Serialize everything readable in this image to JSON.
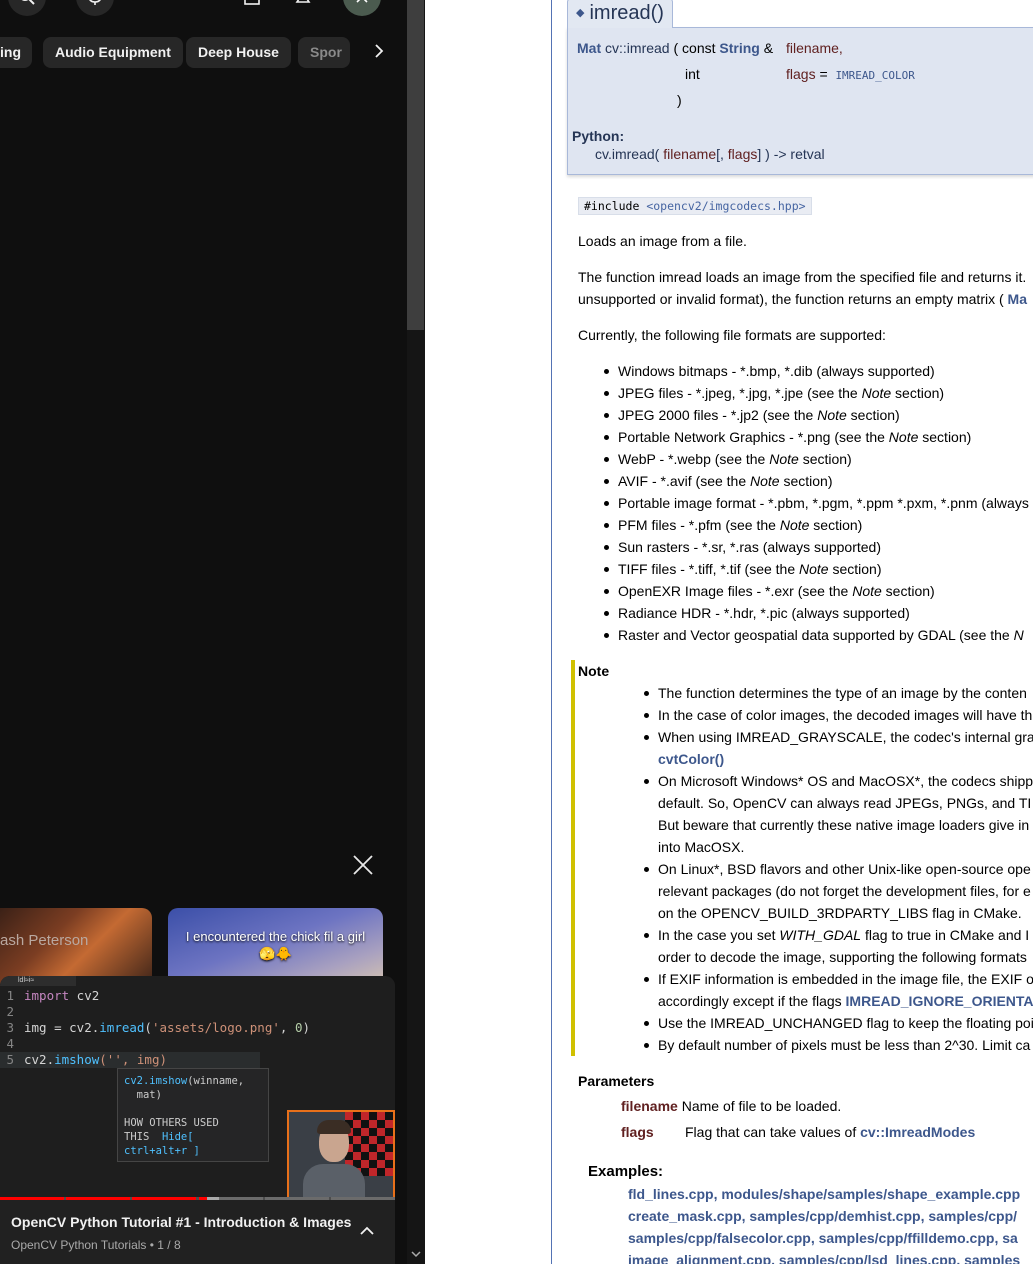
{
  "youtube": {
    "chips": [
      "ing",
      "Audio Equipment",
      "Deep House",
      "Spor"
    ],
    "shorts": [
      {
        "title": "ash Peterson"
      },
      {
        "title": "I encountered the chick fil a girl 🫣🐥"
      }
    ],
    "mini_player": {
      "editor_tab": "ldl≈i≈",
      "code": {
        "l1_num": "1",
        "l1_kw": "import",
        "l1_rest": " cv2",
        "l2_num": "2",
        "l3_num": "3",
        "l3_a": "img = cv2.",
        "l3_fn": "imread",
        "l3_b": "(",
        "l3_str": "'assets/logo.png'",
        "l3_c": ", ",
        "l3_num_val": "0",
        "l3_d": ")",
        "l4_num": "4",
        "l5_num": "5",
        "l5_a": "cv2.",
        "l5_fn": "imshow",
        "l5_b": "('",
        "l5_c": "', img)"
      },
      "autocomplete": {
        "sig_fn": "cv2.imshow",
        "sig_rest": "(winname,",
        "sig_line2": "  mat)",
        "used_line1": "HOW OTHERS USED",
        "used_line2_a": "THIS  ",
        "used_line2_b": "Hide[",
        "used_line3": "ctrl+alt+r ]"
      },
      "title": "OpenCV Python Tutorial #1 - Introduction & Images",
      "subtitle": "OpenCV Python Tutorials • 1 / 8",
      "progress_segments": [
        {
          "color": "#ff0000",
          "fill": 1.0
        },
        {
          "color": "#ff0000",
          "fill": 1.0
        },
        {
          "color": "#ff0000",
          "fill": 1.0
        },
        {
          "color": "#ff0000",
          "fill": 0.14
        },
        {
          "color": "#4d4d4d",
          "fill": 0.0
        },
        {
          "color": "#4d4d4d",
          "fill": 0.0
        }
      ]
    }
  },
  "doc": {
    "member_title": "imread()",
    "proto": {
      "ret_type": "Mat",
      "name": "cv::imread",
      "paren_open": "(",
      "const_kw": "const",
      "string_type": "String",
      "amp": "&",
      "p1_name": "filename,",
      "int_type": "int",
      "p2_name": "flags",
      "eq": "=",
      "default_val": "IMREAD_COLOR",
      "paren_close": ")"
    },
    "python_label": "Python:",
    "python_sig": {
      "fn": "cv.imread(",
      "p1": "filename",
      "opt": "[, ",
      "p2": "flags",
      "close": "] ) -> retval"
    },
    "include": {
      "prefix": "#include ",
      "path": "<opencv2/imgcodecs.hpp>"
    },
    "brief": "Loads an image from a file.",
    "desc_line1": "The function imread loads an image from the specified file and returns it.",
    "desc_line2_text": "unsupported or invalid format), the function returns an empty matrix ( ",
    "desc_line2_link": "Ma",
    "formats_intro": "Currently, the following file formats are supported:",
    "formats": [
      {
        "a": "Windows bitmaps - *.bmp, *.dib (always supported)",
        "i": "",
        "b": ""
      },
      {
        "a": "JPEG files - *.jpeg, *.jpg, *.jpe (see the ",
        "i": "Note",
        "b": " section)"
      },
      {
        "a": "JPEG 2000 files - *.jp2 (see the ",
        "i": "Note",
        "b": " section)"
      },
      {
        "a": "Portable Network Graphics - *.png (see the ",
        "i": "Note",
        "b": " section)"
      },
      {
        "a": "WebP - *.webp (see the ",
        "i": "Note",
        "b": " section)"
      },
      {
        "a": "AVIF - *.avif (see the ",
        "i": "Note",
        "b": " section)"
      },
      {
        "a": "Portable image format - *.pbm, *.pgm, *.ppm *.pxm, *.pnm (always s",
        "i": "",
        "b": ""
      },
      {
        "a": "PFM files - *.pfm (see the ",
        "i": "Note",
        "b": " section)"
      },
      {
        "a": "Sun rasters - *.sr, *.ras (always supported)",
        "i": "",
        "b": ""
      },
      {
        "a": "TIFF files - *.tiff, *.tif (see the ",
        "i": "Note",
        "b": " section)"
      },
      {
        "a": "OpenEXR Image files - *.exr (see the ",
        "i": "Note",
        "b": " section)"
      },
      {
        "a": "Radiance HDR - *.hdr, *.pic (always supported)",
        "i": "",
        "b": ""
      },
      {
        "a": "Raster and Vector geospatial data supported by GDAL (see the ",
        "i": "N",
        "b": ""
      }
    ],
    "note_heading": "Note",
    "notes": [
      {
        "bullet": true,
        "a": "The function determines the type of an image by the conten",
        "link": "",
        "i": "",
        "b": ""
      },
      {
        "bullet": true,
        "a": "In the case of color images, the decoded images will have th",
        "link": "",
        "i": "",
        "b": ""
      },
      {
        "bullet": true,
        "a": "When using IMREAD_GRAYSCALE, the codec's internal gra",
        "link": "",
        "i": "",
        "b": ""
      },
      {
        "bullet": false,
        "a": "",
        "link": "cvtColor()",
        "i": "",
        "b": ""
      },
      {
        "bullet": true,
        "a": "On Microsoft Windows* OS and MacOSX*, the codecs shipp",
        "link": "",
        "i": "",
        "b": ""
      },
      {
        "bullet": false,
        "a": "default. So, OpenCV can always read JPEGs, PNGs, and TI",
        "link": "",
        "i": "",
        "b": ""
      },
      {
        "bullet": false,
        "a": "But beware that currently these native image loaders give in",
        "link": "",
        "i": "",
        "b": ""
      },
      {
        "bullet": false,
        "a": "into MacOSX.",
        "link": "",
        "i": "",
        "b": ""
      },
      {
        "bullet": true,
        "a": "On Linux*, BSD flavors and other Unix-like open-source ope",
        "link": "",
        "i": "",
        "b": ""
      },
      {
        "bullet": false,
        "a": "relevant packages (do not forget the development files, for e",
        "link": "",
        "i": "",
        "b": ""
      },
      {
        "bullet": false,
        "a": "on the OPENCV_BUILD_3RDPARTY_LIBS flag in CMake.",
        "link": "",
        "i": "",
        "b": ""
      },
      {
        "bullet": true,
        "a": "In the case you set ",
        "link": "",
        "i": "WITH_GDAL",
        "b": " flag to true in CMake and I"
      },
      {
        "bullet": false,
        "a": "order to decode the image, supporting the following formats",
        "link": "",
        "i": "",
        "b": ""
      },
      {
        "bullet": true,
        "a": "If EXIF information is embedded in the image file, the EXIF o",
        "link": "",
        "i": "",
        "b": ""
      },
      {
        "bullet": false,
        "a": "accordingly except if the flags ",
        "link": "IMREAD_IGNORE_ORIENTA",
        "i": "",
        "b": ""
      },
      {
        "bullet": true,
        "a": "Use the IMREAD_UNCHANGED flag to keep the floating poir",
        "link": "",
        "i": "",
        "b": ""
      },
      {
        "bullet": true,
        "a": "By default number of pixels must be less than 2^30. Limit ca",
        "link": "",
        "i": "",
        "b": ""
      }
    ],
    "params_heading": "Parameters",
    "params": [
      {
        "name": "filename",
        "desc": "Name of file to be loaded.",
        "link": ""
      },
      {
        "name": "flags",
        "desc": "Flag that can take values of ",
        "link": "cv::ImreadModes"
      }
    ],
    "examples_heading": "Examples:",
    "examples_lines": [
      "fld_lines.cpp, modules/shape/samples/shape_example.cpp",
      "create_mask.cpp, samples/cpp/demhist.cpp, samples/cpp/",
      "samples/cpp/falsecolor.cpp, samples/cpp/ffilldemo.cpp, sa",
      "image_alignment.cpp, samples/cpp/lsd_lines.cpp, samples"
    ]
  },
  "colors": {
    "yt_bg": "#0f0f0f",
    "chip_bg": "#272727",
    "progress_red": "#ff0000",
    "doc_link": "#3d578c",
    "note_bar": "#d0c000",
    "proto_bg": "#dfe5f1",
    "webcam_border": "#e8701a"
  }
}
